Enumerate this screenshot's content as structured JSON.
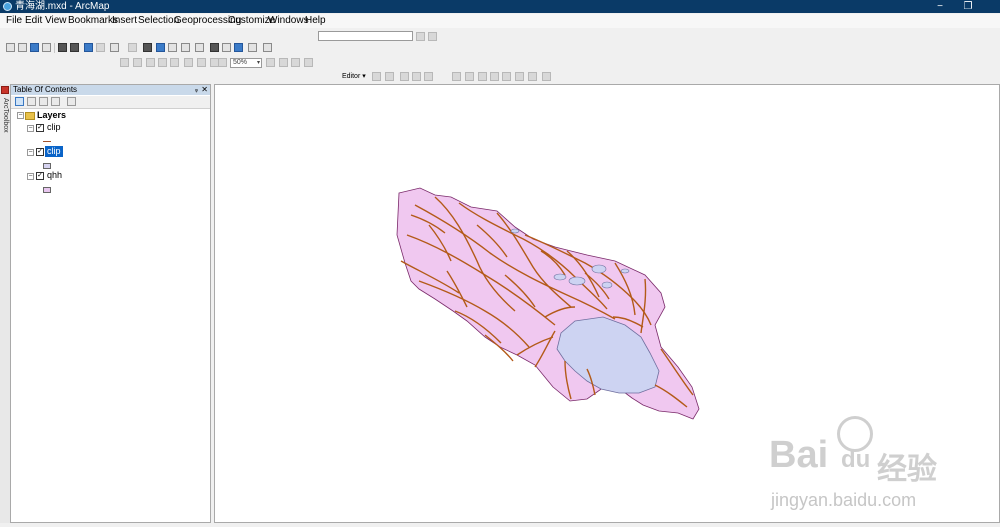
{
  "window": {
    "title": "青海湖.mxd - ArcMap",
    "minimize": "−",
    "restore": "❐"
  },
  "menu": [
    {
      "id": "file",
      "label": "File"
    },
    {
      "id": "edit",
      "label": "Edit"
    },
    {
      "id": "view",
      "label": "View"
    },
    {
      "id": "bookmarks",
      "label": "Bookmarks"
    },
    {
      "id": "insert",
      "label": "Insert"
    },
    {
      "id": "selection",
      "label": "Selection"
    },
    {
      "id": "geoprocessing",
      "label": "Geoprocessing"
    },
    {
      "id": "customize",
      "label": "Customize"
    },
    {
      "id": "windows",
      "label": "Windows"
    },
    {
      "id": "help",
      "label": "Help"
    }
  ],
  "toolbar": {
    "scale_value": "",
    "zoom_percent": "50%",
    "editor_label": "Editor ▾"
  },
  "toc": {
    "title": "Table Of Contents",
    "pin_glyph": "ᵩ",
    "close_glyph": "✕",
    "root": {
      "label": "Layers"
    },
    "layers": [
      {
        "name": "clip",
        "checked": true,
        "selected": false,
        "symbol": "line",
        "symbol_color": "#a0522d"
      },
      {
        "name": "clip",
        "checked": true,
        "selected": true,
        "symbol": "polygon",
        "symbol_color": "#d6d3f0"
      },
      {
        "name": "qhh",
        "checked": true,
        "selected": false,
        "symbol": "polygon",
        "symbol_color": "#e8c6ef"
      }
    ]
  },
  "side_tab": {
    "label": "ArcToolbox"
  },
  "map": {
    "polygon_fill": "#f0c8f0",
    "river_color": "#b35a18",
    "lake_fill": "#cdd3f2"
  },
  "watermark": {
    "brand": "Bai",
    "paw": "du",
    "cn": "经验",
    "url": "jingyan.baidu.com"
  },
  "glyphs": {
    "check": "✓",
    "minus": "−"
  }
}
